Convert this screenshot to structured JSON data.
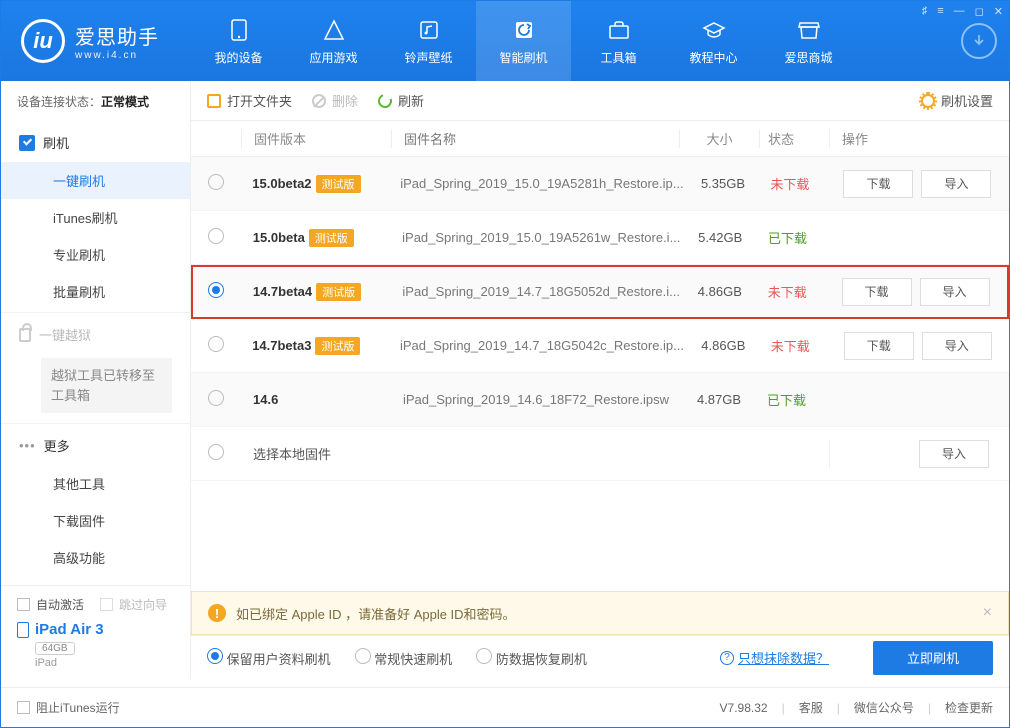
{
  "app": {
    "name_cn": "爱思助手",
    "name_en": "www.i4.cn"
  },
  "nav": {
    "items": [
      {
        "label": "我的设备"
      },
      {
        "label": "应用游戏"
      },
      {
        "label": "铃声壁纸"
      },
      {
        "label": "智能刷机"
      },
      {
        "label": "工具箱"
      },
      {
        "label": "教程中心"
      },
      {
        "label": "爱思商城"
      }
    ],
    "active": 3
  },
  "status": {
    "label": "设备连接状态：",
    "value": "正常模式"
  },
  "sidebar": {
    "flash_head": "刷机",
    "flash_items": [
      "一键刷机",
      "iTunes刷机",
      "专业刷机",
      "批量刷机"
    ],
    "flash_active": 0,
    "jailbreak_head": "一键越狱",
    "jailbreak_note": "越狱工具已转移至工具箱",
    "more_head": "更多",
    "more_items": [
      "其他工具",
      "下载固件",
      "高级功能"
    ]
  },
  "toolbar": {
    "open": "打开文件夹",
    "delete": "删除",
    "refresh": "刷新",
    "settings": "刷机设置"
  },
  "columns": {
    "ver": "固件版本",
    "name": "固件名称",
    "size": "大小",
    "status": "状态",
    "action": "操作"
  },
  "badge": "测试版",
  "actions": {
    "download": "下载",
    "import": "导入"
  },
  "status_labels": {
    "not": "未下载",
    "done": "已下载"
  },
  "rows": [
    {
      "ver": "15.0beta2",
      "beta": true,
      "name": "iPad_Spring_2019_15.0_19A5281h_Restore.ip...",
      "size": "5.35GB",
      "st": "not",
      "dl": true,
      "imp": true,
      "sel": false
    },
    {
      "ver": "15.0beta",
      "beta": true,
      "name": "iPad_Spring_2019_15.0_19A5261w_Restore.i...",
      "size": "5.42GB",
      "st": "done",
      "dl": false,
      "imp": false,
      "sel": false
    },
    {
      "ver": "14.7beta4",
      "beta": true,
      "name": "iPad_Spring_2019_14.7_18G5052d_Restore.i...",
      "size": "4.86GB",
      "st": "not",
      "dl": true,
      "imp": true,
      "sel": true,
      "hl": true
    },
    {
      "ver": "14.7beta3",
      "beta": true,
      "name": "iPad_Spring_2019_14.7_18G5042c_Restore.ip...",
      "size": "4.86GB",
      "st": "not",
      "dl": true,
      "imp": true,
      "sel": false
    },
    {
      "ver": "14.6",
      "beta": false,
      "name": "iPad_Spring_2019_14.6_18F72_Restore.ipsw",
      "size": "4.87GB",
      "st": "done",
      "dl": false,
      "imp": false,
      "sel": false
    }
  ],
  "local_row": "选择本地固件",
  "warning": "如已绑定 Apple ID ，请准备好 Apple ID和密码。",
  "options": {
    "items": [
      "保留用户资料刷机",
      "常规快速刷机",
      "防数据恢复刷机"
    ],
    "selected": 0,
    "erase_link": "只想抹除数据？",
    "go": "立即刷机"
  },
  "checkboxes": {
    "auto": "自动激活",
    "skip": "跳过向导",
    "block": "阻止iTunes运行"
  },
  "device": {
    "name": "iPad Air 3",
    "storage": "64GB",
    "type": "iPad"
  },
  "footer": {
    "version": "V7.98.32",
    "links": [
      "客服",
      "微信公众号",
      "检查更新"
    ]
  }
}
